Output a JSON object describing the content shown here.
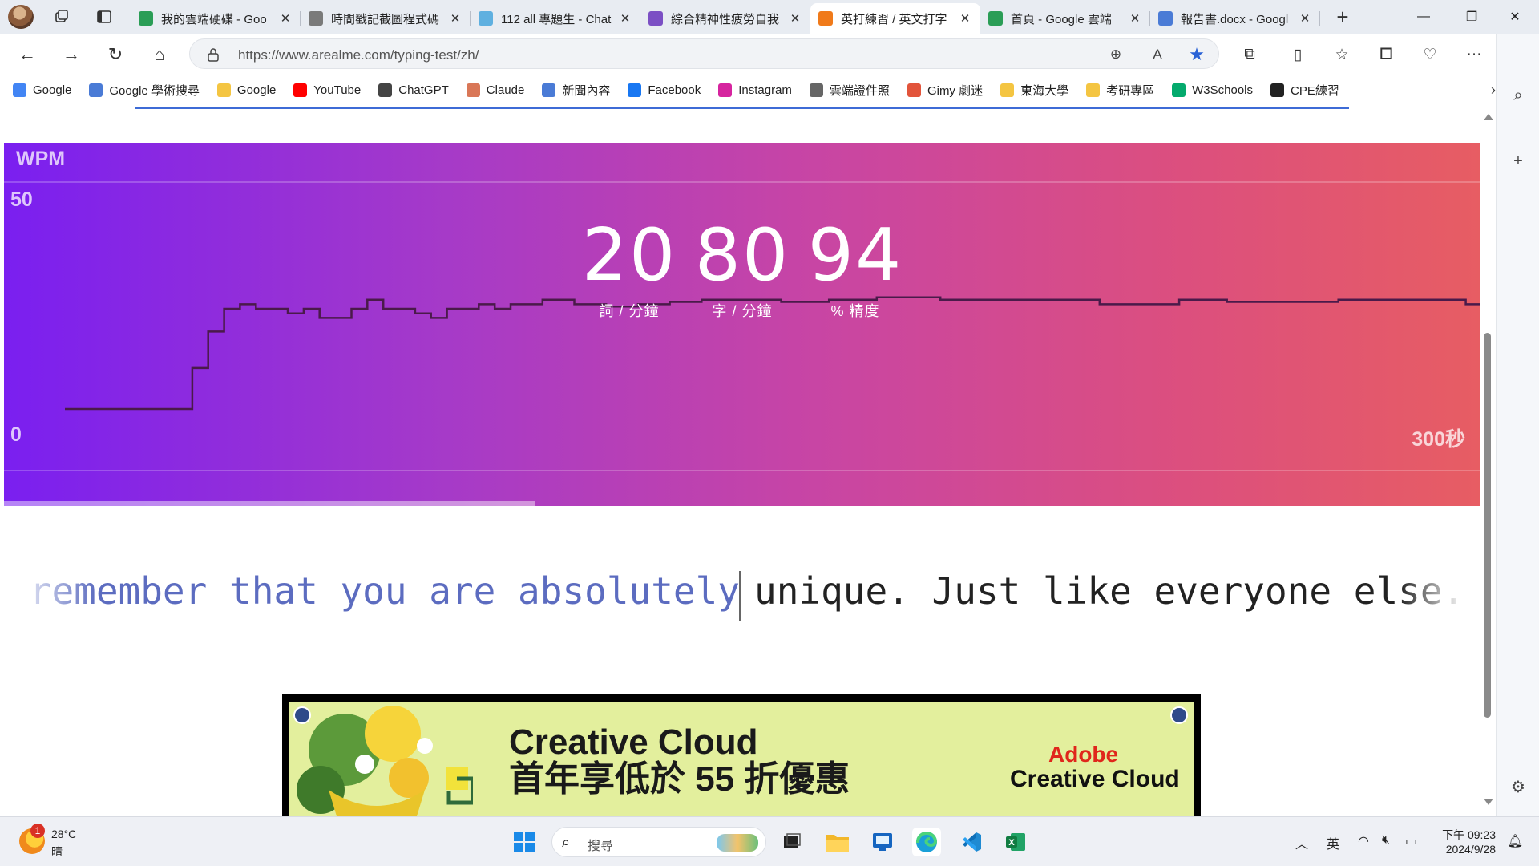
{
  "browser": {
    "tabs": [
      {
        "title": "我的雲端硬碟 - Goo",
        "icon": "google-drive-icon",
        "active": false
      },
      {
        "title": "時間戳記截圖程式碼",
        "icon": "chatgpt-icon",
        "active": false
      },
      {
        "title": "112 all 專題生 - Chat",
        "icon": "doc-icon",
        "active": false
      },
      {
        "title": "綜合精神性疲勞自我",
        "icon": "forms-icon",
        "active": false
      },
      {
        "title": "英打練習 / 英文打字",
        "icon": "fox-icon",
        "active": true
      },
      {
        "title": "首頁 - Google 雲端",
        "icon": "google-drive-icon",
        "active": false
      },
      {
        "title": "報告書.docx - Googl",
        "icon": "docs-icon",
        "active": false
      }
    ],
    "url": "https://www.arealme.com/typing-test/zh/",
    "bookmarks": [
      {
        "label": "Google",
        "icon": "google-icon",
        "color": "#4285f4"
      },
      {
        "label": "Google 學術搜尋",
        "icon": "scholar-icon",
        "color": "#4a7bd6"
      },
      {
        "label": "Google",
        "icon": "folder-icon",
        "color": "#f4c542"
      },
      {
        "label": "YouTube",
        "icon": "youtube-icon",
        "color": "#ff0000"
      },
      {
        "label": "ChatGPT",
        "icon": "chatgpt-icon",
        "color": "#444444"
      },
      {
        "label": "Claude",
        "icon": "claude-icon",
        "color": "#d97757"
      },
      {
        "label": "新聞內容",
        "icon": "news-icon",
        "color": "#4a7bd6"
      },
      {
        "label": "Facebook",
        "icon": "facebook-icon",
        "color": "#1877f2"
      },
      {
        "label": "Instagram",
        "icon": "instagram-icon",
        "color": "#d6249f"
      },
      {
        "label": "雲端證件照",
        "icon": "page-icon",
        "color": "#666666"
      },
      {
        "label": "Gimy 劇迷",
        "icon": "gimy-icon",
        "color": "#e2543b"
      },
      {
        "label": "東海大學",
        "icon": "folder-icon",
        "color": "#f4c542"
      },
      {
        "label": "考研專區",
        "icon": "folder-icon",
        "color": "#f4c542"
      },
      {
        "label": "W3Schools",
        "icon": "w3schools-icon",
        "color": "#04aa6d"
      },
      {
        "label": "CPE練習",
        "icon": "github-icon",
        "color": "#222222"
      }
    ]
  },
  "test": {
    "chart_label": "WPM",
    "y_max_label": "50",
    "y_min_label": "0",
    "x_max_label": "300秒",
    "stats": [
      {
        "value": "20",
        "label": "詞 / 分鐘"
      },
      {
        "value": "80",
        "label": "字 / 分鐘"
      },
      {
        "value": "94",
        "label": "% 精度"
      }
    ],
    "typed_text": "ys remember that you are absolutely",
    "untyped_text": "unique. Just like everyone else. Ma",
    "progress": 0.36
  },
  "chart_data": {
    "type": "line",
    "title": "",
    "ylabel": "WPM",
    "xlabel": "",
    "ylim": [
      0,
      50
    ],
    "xlim": [
      0,
      300
    ],
    "x_tick_labels": [
      "0",
      "300秒"
    ],
    "series": [
      {
        "values": [
          [
            0,
            0
          ],
          [
            8,
            0
          ],
          [
            8,
            9
          ],
          [
            9,
            9
          ],
          [
            9,
            17
          ],
          [
            10,
            17
          ],
          [
            10,
            22
          ],
          [
            11,
            22
          ],
          [
            11,
            23
          ],
          [
            12,
            23
          ],
          [
            12,
            22
          ],
          [
            14,
            22
          ],
          [
            14,
            21
          ],
          [
            15,
            21
          ],
          [
            15,
            22
          ],
          [
            16,
            22
          ],
          [
            16,
            20
          ],
          [
            18,
            20
          ],
          [
            18,
            22
          ],
          [
            19,
            22
          ],
          [
            19,
            24
          ],
          [
            20,
            24
          ],
          [
            20,
            22
          ],
          [
            22,
            22
          ],
          [
            22,
            21
          ],
          [
            23,
            21
          ],
          [
            23,
            20
          ],
          [
            24,
            20
          ],
          [
            24,
            22
          ],
          [
            26,
            22
          ],
          [
            26,
            23
          ],
          [
            27,
            23
          ],
          [
            27,
            22
          ],
          [
            28,
            22
          ],
          [
            28,
            23
          ],
          [
            30,
            23
          ],
          [
            30,
            24
          ],
          [
            32,
            24
          ],
          [
            32,
            23
          ],
          [
            34,
            23
          ],
          [
            34,
            22.5
          ],
          [
            36,
            22.5
          ],
          [
            36,
            23
          ],
          [
            38,
            23
          ],
          [
            38,
            23.5
          ],
          [
            40,
            23.5
          ],
          [
            40,
            24
          ],
          [
            45,
            24
          ],
          [
            45,
            23.5
          ],
          [
            48,
            23.5
          ],
          [
            48,
            24
          ],
          [
            51,
            24
          ],
          [
            51,
            24.5
          ],
          [
            55,
            24.5
          ],
          [
            55,
            24
          ],
          [
            65,
            24
          ],
          [
            65,
            23
          ],
          [
            70,
            23
          ],
          [
            70,
            24
          ],
          [
            73,
            24
          ],
          [
            73,
            23.5
          ],
          [
            80,
            23.5
          ],
          [
            80,
            24
          ],
          [
            88,
            24
          ],
          [
            88,
            23
          ],
          [
            92,
            23
          ],
          [
            92,
            23.5
          ],
          [
            95,
            23.5
          ],
          [
            95,
            23
          ],
          [
            100,
            23
          ],
          [
            100,
            22.5
          ],
          [
            104,
            22.5
          ],
          [
            104,
            23
          ],
          [
            108,
            23
          ],
          [
            108,
            22
          ],
          [
            112,
            22
          ],
          [
            112,
            21.5
          ],
          [
            118,
            21.5
          ],
          [
            118,
            22
          ],
          [
            121,
            22
          ],
          [
            121,
            21.5
          ],
          [
            124,
            21.5
          ],
          [
            124,
            21
          ],
          [
            130,
            21
          ],
          [
            130,
            21.5
          ],
          [
            134,
            21.5
          ],
          [
            134,
            21
          ],
          [
            144,
            21
          ],
          [
            144,
            21
          ]
        ]
      }
    ],
    "grid": true
  },
  "ad": {
    "headline_line1": "Creative Cloud",
    "headline_line2": "首年享低於 55 折優惠",
    "brand_line1": "Adobe",
    "brand_line2": "Creative Cloud"
  },
  "taskbar": {
    "weather_badge": "1",
    "temperature": "28°C",
    "condition": "晴",
    "search_placeholder": "搜尋",
    "ime": "英",
    "time": "下午 09:23",
    "date": "2024/9/28"
  }
}
